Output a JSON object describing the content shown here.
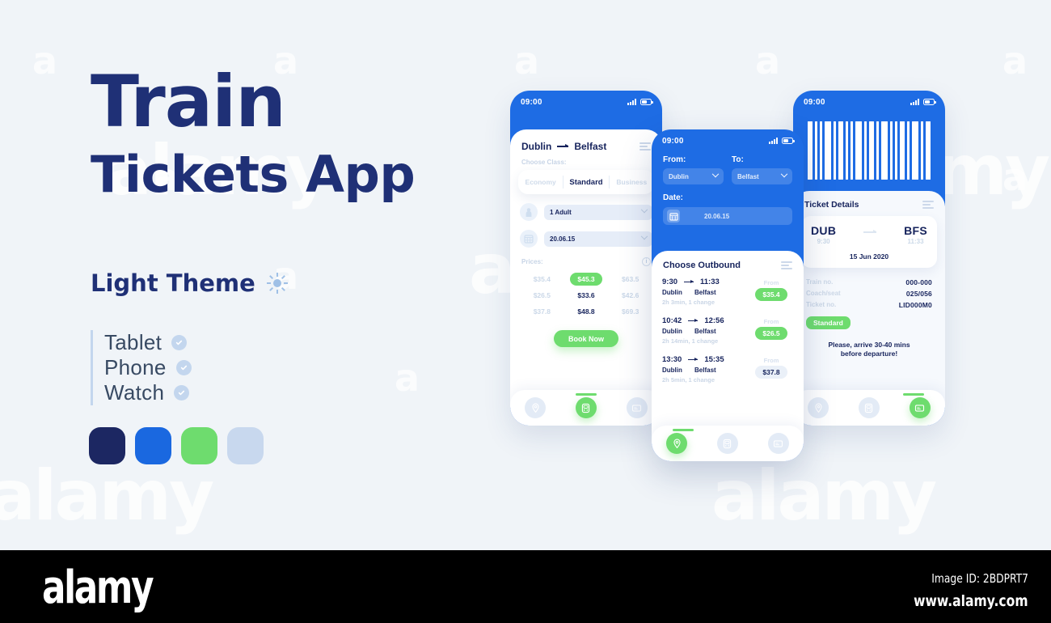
{
  "background": {
    "color": "#f0f4f8",
    "watermark_text": "alamy",
    "watermark_letter": "a"
  },
  "hero": {
    "title_line1": "Train",
    "title_line2": "Tickets App",
    "theme_label": "Light Theme",
    "theme_icon": "sun-icon",
    "devices": [
      {
        "label": "Tablet",
        "checked": true
      },
      {
        "label": "Phone",
        "checked": true
      },
      {
        "label": "Watch",
        "checked": true
      }
    ],
    "swatches": [
      "#1c2762",
      "#1a68e0",
      "#6edc6e",
      "#c8d8ee"
    ]
  },
  "colors": {
    "navy": "#16235c",
    "blue": "#1e6ce4",
    "green": "#6edc6e",
    "light_blue": "#c8d8ee",
    "muted": "#c7d4e6"
  },
  "phone1": {
    "status": {
      "time": "09:00"
    },
    "from": "Dublin",
    "to": "Belfast",
    "class_label": "Choose Class:",
    "classes": [
      "Economy",
      "Standard",
      "Business"
    ],
    "selected_class": "Standard",
    "passengers": "1 Adult",
    "date": "20.06.15",
    "prices_label": "Prices:",
    "price_rows": [
      [
        "$35.4",
        "$45.3",
        "$63.5"
      ],
      [
        "$26.5",
        "$33.6",
        "$42.6"
      ],
      [
        "$37.8",
        "$48.8",
        "$69.3"
      ]
    ],
    "selected_price": "$45.3",
    "book_button": "Book Now",
    "nav": [
      {
        "icon": "location-pin-icon",
        "active": false
      },
      {
        "icon": "ticket-icon",
        "active": true
      },
      {
        "icon": "card-icon",
        "active": false
      }
    ]
  },
  "phone2": {
    "status": {
      "time": "09:00"
    },
    "from_label": "From:",
    "to_label": "To:",
    "from_value": "Dublin",
    "to_value": "Belfast",
    "date_label": "Date:",
    "date_value": "20.06.15",
    "sheet_title": "Choose Outbound",
    "trips": [
      {
        "depart": "9:30",
        "arrive": "11:33",
        "from": "Dublin",
        "to": "Belfast",
        "duration": "2h 3min, 1 change",
        "from_label": "From",
        "price": "$35.4",
        "highlight": true
      },
      {
        "depart": "10:42",
        "arrive": "12:56",
        "from": "Dublin",
        "to": "Belfast",
        "duration": "2h 14min, 1 change",
        "from_label": "From",
        "price": "$26.5",
        "highlight": true
      },
      {
        "depart": "13:30",
        "arrive": "15:35",
        "from": "Dublin",
        "to": "Belfast",
        "duration": "2h 5min, 1 change",
        "from_label": "From",
        "price": "$37.8",
        "highlight": false
      }
    ],
    "nav": [
      {
        "icon": "location-pin-icon",
        "active": true
      },
      {
        "icon": "ticket-icon",
        "active": false
      },
      {
        "icon": "card-icon",
        "active": false
      }
    ]
  },
  "phone3": {
    "status": {
      "time": "09:00"
    },
    "sheet_title": "Ticket Details",
    "origin_code": "DUB",
    "origin_time": "9:30",
    "dest_code": "BFS",
    "dest_time": "11:33",
    "date": "15 Jun 2020",
    "meta": [
      {
        "key": "Train no.",
        "value": "000-000"
      },
      {
        "key": "Coach/seat",
        "value": "025/056"
      },
      {
        "key": "Ticket no.",
        "value": "LID000M0"
      }
    ],
    "class_pill": "Standard",
    "notice_line1": "Please, arrive 30-40 mins",
    "notice_line2": "before departure!",
    "nav": [
      {
        "icon": "location-pin-icon",
        "active": false
      },
      {
        "icon": "ticket-icon",
        "active": false
      },
      {
        "icon": "card-icon",
        "active": true
      }
    ]
  },
  "footer": {
    "logo": "alamy",
    "image_id": "Image ID: 2BDPRT7",
    "url": "www.alamy.com"
  }
}
